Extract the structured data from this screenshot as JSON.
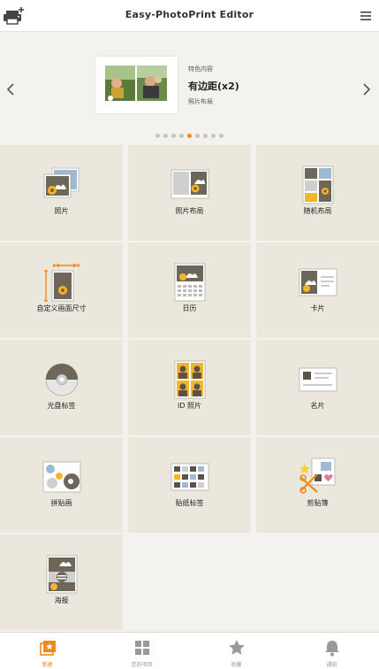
{
  "header": {
    "title": "Easy-PhotoPrint Editor"
  },
  "carousel": {
    "feature_label": "特色内容",
    "feature_title": "有边距(x2)",
    "feature_subtitle": "照片布局",
    "dot_count": 9,
    "active_dot": 4
  },
  "tiles": [
    {
      "label": "照片",
      "icon": "photo-icon"
    },
    {
      "label": "照片布局",
      "icon": "photo-layout-icon"
    },
    {
      "label": "随机布局",
      "icon": "random-layout-icon"
    },
    {
      "label": "自定义画面尺寸",
      "icon": "custom-size-icon"
    },
    {
      "label": "日历",
      "icon": "calendar-icon"
    },
    {
      "label": "卡片",
      "icon": "card-icon"
    },
    {
      "label": "光盘标签",
      "icon": "disc-label-icon"
    },
    {
      "label": "ID 照片",
      "icon": "id-photo-icon"
    },
    {
      "label": "名片",
      "icon": "business-card-icon"
    },
    {
      "label": "拼贴画",
      "icon": "collage-icon"
    },
    {
      "label": "贴纸标签",
      "icon": "sticker-icon"
    },
    {
      "label": "剪贴簿",
      "icon": "scrapbook-icon"
    },
    {
      "label": "海报",
      "icon": "poster-icon"
    }
  ],
  "nav": [
    {
      "label": "新建",
      "icon": "new-icon",
      "active": true
    },
    {
      "label": "您的项目",
      "icon": "projects-icon",
      "active": false
    },
    {
      "label": "收藏",
      "icon": "favorites-icon",
      "active": false
    },
    {
      "label": "通知",
      "icon": "notifications-icon",
      "active": false
    }
  ],
  "colors": {
    "accent": "#f08a1a",
    "tile_bg": "#ece7dd",
    "page_bg": "#f4f2ee"
  }
}
